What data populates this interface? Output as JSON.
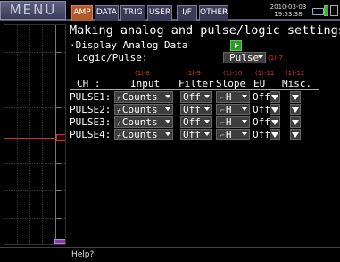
{
  "topbar": {
    "menu_label": "MENU",
    "tabs": [
      {
        "label": "AMP",
        "active": true
      },
      {
        "label": "DATA",
        "active": false
      },
      {
        "label": "TRIG",
        "active": false
      },
      {
        "label": "USER",
        "active": false
      },
      {
        "label": "I/F",
        "active": false
      },
      {
        "label": "OTHER",
        "active": false
      }
    ],
    "date": "2010-03-03",
    "time": "19:53:38"
  },
  "panel": {
    "title": "Making analog and pulse/logic settings",
    "display_analog_label": "·Display Analog Data",
    "logic_pulse_label": "Logic/Pulse:",
    "logic_pulse_value": "Pulse",
    "logic_pulse_ref": "(1)-7",
    "column_refs": [
      "(1)-8",
      "(1)-9",
      "(1)-10",
      "(1)-11",
      "(1)-12"
    ],
    "headers": {
      "ch": "CH  :",
      "input": "Input",
      "filter": "Filter",
      "slope": "Slope",
      "eu": "EU",
      "misc": "Misc."
    },
    "rows": [
      {
        "ch": "PULSE1:",
        "input": "Counts",
        "filter": "Off",
        "slope": "H",
        "eu": "Off"
      },
      {
        "ch": "PULSE2:",
        "input": "Counts",
        "filter": "Off",
        "slope": "H",
        "eu": "Off"
      },
      {
        "ch": "PULSE3:",
        "input": "Counts",
        "filter": "Off",
        "slope": "H",
        "eu": "Off"
      },
      {
        "ch": "PULSE4:",
        "input": "Counts",
        "filter": "Off",
        "slope": "H",
        "eu": "Off"
      }
    ]
  },
  "status": {
    "help": "Help?"
  },
  "colors": {
    "accent": "#b05a2a",
    "ref_red": "#e03030",
    "green": "#2a9a2a"
  }
}
